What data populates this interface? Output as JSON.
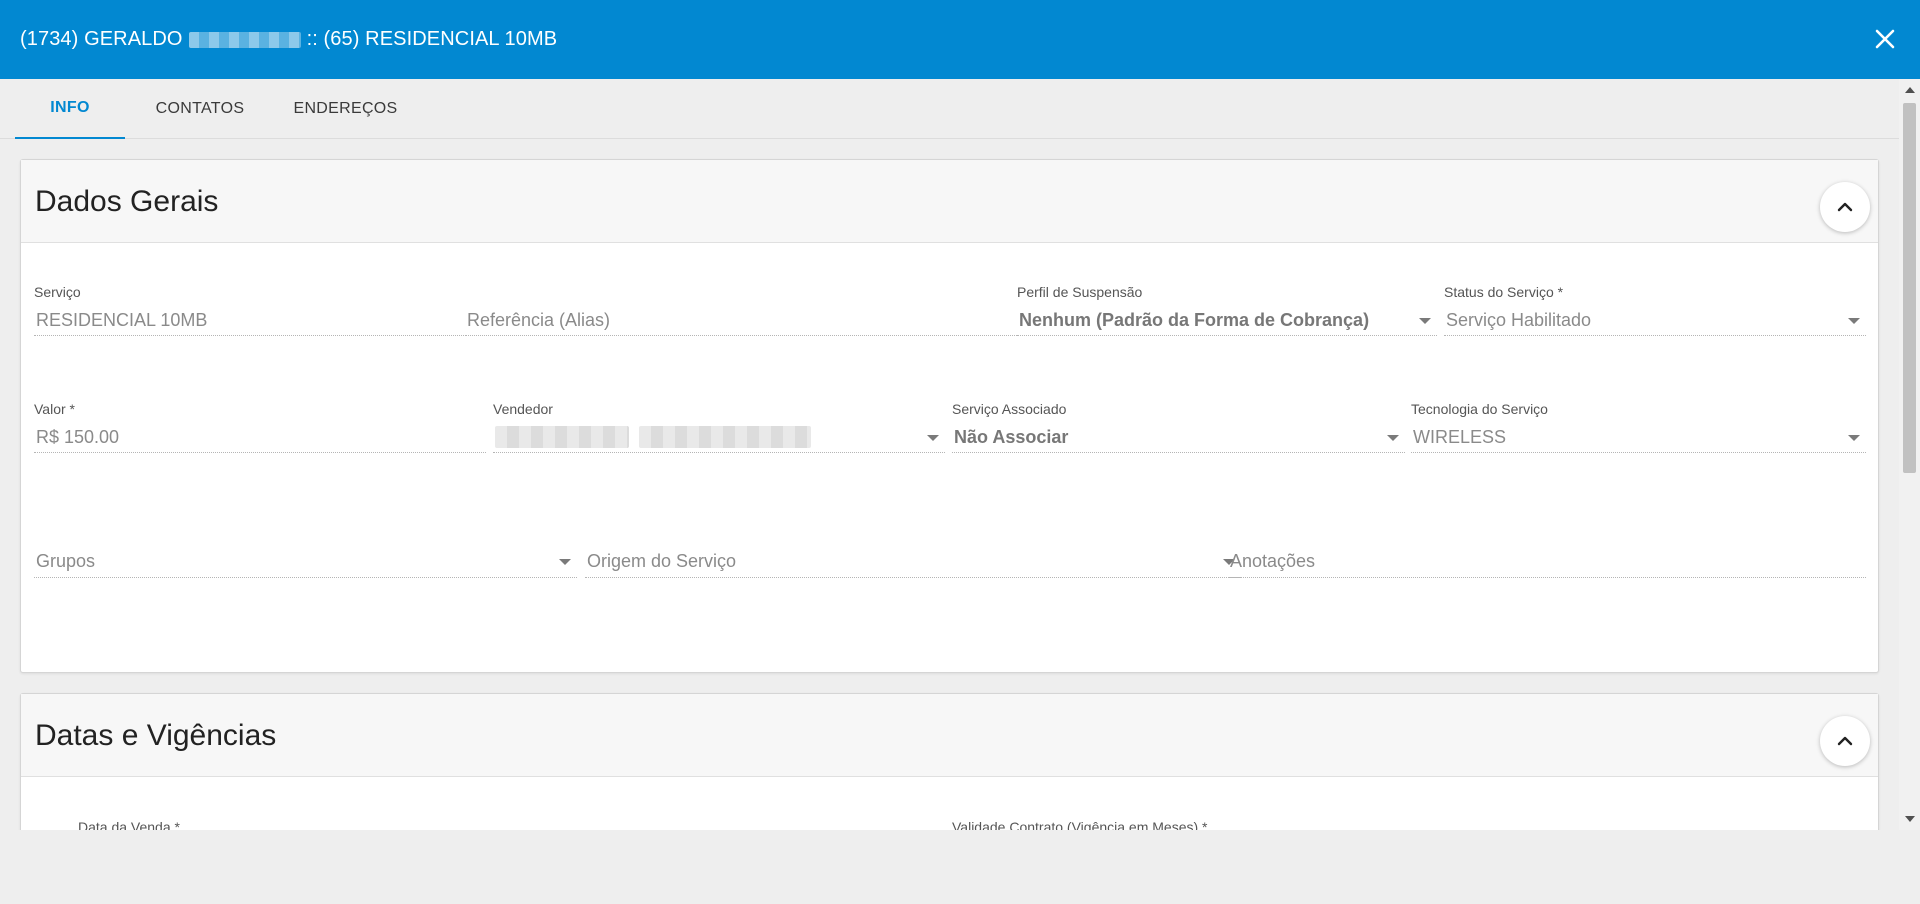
{
  "dialog": {
    "title_prefix": "(1734) GERALDO",
    "title_suffix": ":: (65) RESIDENCIAL 10MB"
  },
  "tabs": [
    {
      "label": "INFO",
      "active": true
    },
    {
      "label": "CONTATOS",
      "active": false
    },
    {
      "label": "ENDEREÇOS",
      "active": false
    }
  ],
  "dados_gerais": {
    "title": "Dados Gerais",
    "servico": {
      "label": "Serviço",
      "value": "RESIDENCIAL 10MB"
    },
    "referencia": {
      "placeholder": "Referência (Alias)"
    },
    "perfil_suspensao": {
      "label": "Perfil de Suspensão",
      "value": "Nenhum (Padrão da Forma de Cobrança)"
    },
    "status_servico": {
      "label": "Status do Serviço *",
      "value": "Serviço Habilitado"
    },
    "valor": {
      "label": "Valor *",
      "value": "R$ 150.00"
    },
    "vendedor": {
      "label": "Vendedor"
    },
    "servico_associado": {
      "label": "Serviço Associado",
      "value": "Não Associar"
    },
    "tecnologia": {
      "label": "Tecnologia do Serviço",
      "value": "WIRELESS"
    },
    "grupos": {
      "placeholder": "Grupos"
    },
    "origem": {
      "placeholder": "Origem do Serviço"
    },
    "anotacoes": {
      "placeholder": "Anotações"
    }
  },
  "datas_vigencias": {
    "title": "Datas e Vigências",
    "data_venda_label": "Data da Venda *",
    "validade_label": "Validade Contrato (Vigência em Meses) *"
  },
  "colors": {
    "accent": "#0288d1",
    "background": "#eeeeee"
  }
}
